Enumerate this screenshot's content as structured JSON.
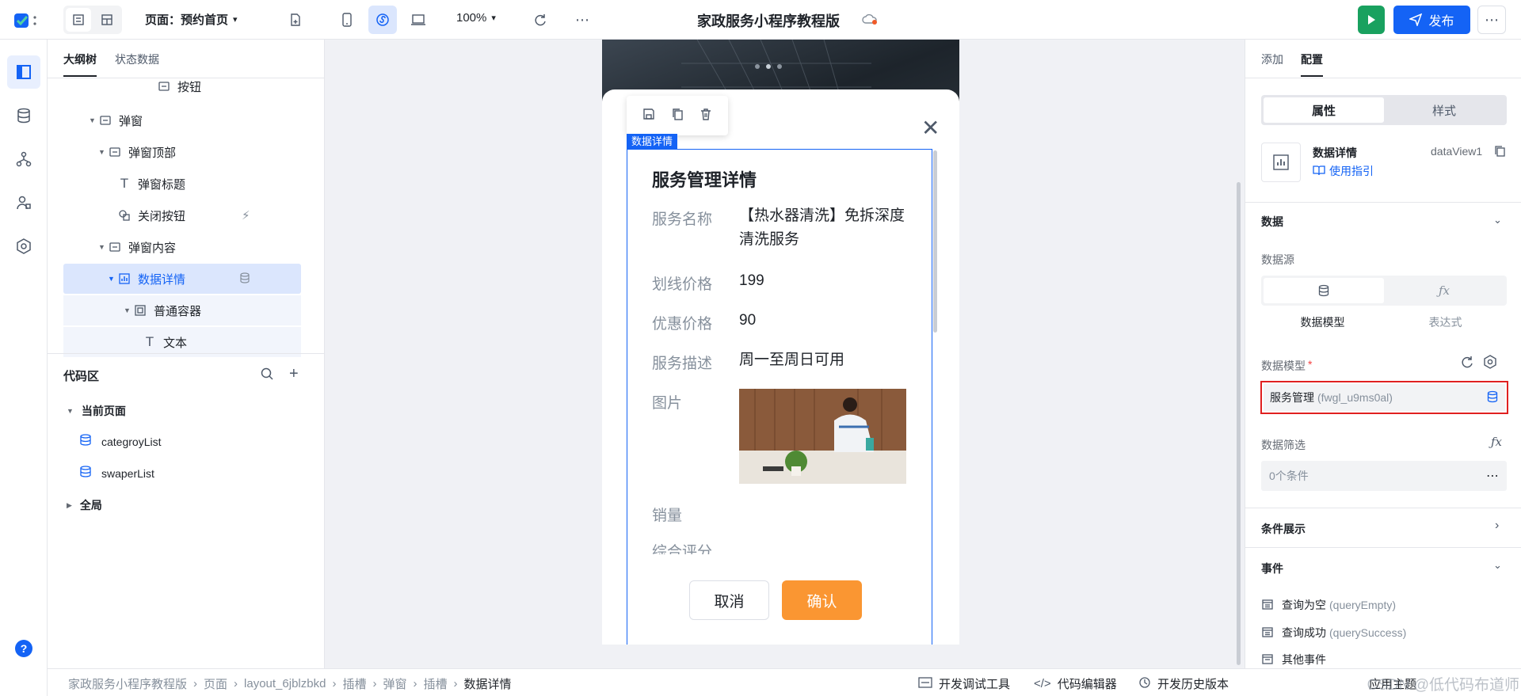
{
  "app": {
    "logo_icon": "app-logo-icon"
  },
  "toolbar": {
    "page_label": "页面：预约首页",
    "zoom": "100%",
    "title": "家政服务小程序教程版",
    "publish_label": "发布",
    "more": "⋯"
  },
  "left": {
    "tabs": [
      "大纲树",
      "状态数据"
    ],
    "tree": [
      {
        "label": "按钮"
      },
      {
        "label": "弹窗"
      },
      {
        "label": "弹窗顶部"
      },
      {
        "label": "弹窗标题"
      },
      {
        "label": "关闭按钮"
      },
      {
        "label": "弹窗内容"
      },
      {
        "label": "数据详情"
      },
      {
        "label": "普通容器"
      },
      {
        "label": "文本"
      }
    ],
    "code": {
      "title": "代码区",
      "current_page": "当前页面",
      "items": [
        "categroyList",
        "swaperList"
      ],
      "global": "全局"
    }
  },
  "preview": {
    "badge": "数据详情",
    "heading": "服务管理详情",
    "fields": [
      {
        "label": "服务名称",
        "value": "【热水器清洗】免拆深度清洗服务"
      },
      {
        "label": "划线价格",
        "value": "199"
      },
      {
        "label": "优惠价格",
        "value": "90"
      },
      {
        "label": "服务描述",
        "value": "周一至周日可用"
      },
      {
        "label": "图片",
        "value": ""
      },
      {
        "label": "销量",
        "value": ""
      },
      {
        "label": "综合评分",
        "value": ""
      }
    ],
    "cancel": "取消",
    "confirm": "确认"
  },
  "right": {
    "tabs": [
      "添加",
      "配置"
    ],
    "seg": [
      "属性",
      "样式"
    ],
    "component": {
      "name": "数据详情",
      "id": "dataView1",
      "guide": "使用指引"
    },
    "data_section": "数据",
    "source_label": "数据源",
    "source_options": [
      "数据模型",
      "表达式"
    ],
    "model_label": "数据模型",
    "model_required": "*",
    "model_value": "服务管理",
    "model_code": "(fwgl_u9ms0al)",
    "filter_label": "数据筛选",
    "filter_value": "0个条件",
    "cond_label": "条件展示",
    "event_label": "事件",
    "events": [
      {
        "name": "查询为空",
        "code": "(queryEmpty)"
      },
      {
        "name": "查询成功",
        "code": "(querySuccess)"
      },
      {
        "name": "其他事件",
        "code": ""
      }
    ]
  },
  "footer": {
    "breadcrumb": [
      "家政服务小程序教程版",
      "页面",
      "layout_6jblzbkd",
      "插槽",
      "弹窗",
      "插槽",
      "数据详情"
    ],
    "tools": [
      "开发调试工具",
      "代码编辑器",
      "开发历史版本"
    ],
    "watermark": "CSDN @低代码布道师",
    "theme": "应用主题"
  },
  "colors": {
    "accent": "#1463f5",
    "green": "#19a15f",
    "orange": "#fa8c28",
    "selected_bg": "#dbe6fd",
    "red_box": "#e02020"
  }
}
